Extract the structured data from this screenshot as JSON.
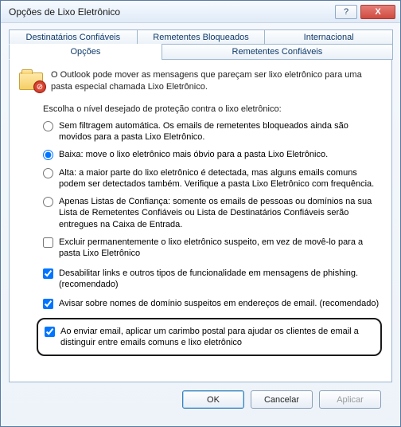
{
  "window": {
    "title": "Opções de Lixo Eletrônico",
    "help_glyph": "?",
    "close_glyph": "X"
  },
  "tabs": {
    "row1": [
      {
        "label": "Destinatários Confiáveis"
      },
      {
        "label": "Remetentes Bloqueados"
      },
      {
        "label": "Internacional"
      }
    ],
    "row2": [
      {
        "label": "Opções",
        "active": true
      },
      {
        "label": "Remetentes Confiáveis"
      }
    ]
  },
  "intro": "O Outlook pode mover as mensagens que pareçam ser lixo eletrônico para uma pasta especial chamada Lixo Eletrônico.",
  "section_label": "Escolha o nível desejado de proteção contra o lixo eletrônico:",
  "radios": {
    "none": "Sem filtragem automática. Os emails de remetentes bloqueados ainda são movidos para a pasta Lixo Eletrônico.",
    "low": "Baixa: move o lixo eletrônico mais óbvio para a pasta Lixo Eletrônico.",
    "high": "Alta: a maior parte do lixo eletrônico é detectada, mas alguns emails comuns podem ser detectados também. Verifique a pasta Lixo Eletrônico com frequência.",
    "safe": "Apenas Listas de Confiança: somente os emails de pessoas ou domínios na sua Lista de Remetentes Confiáveis ou Lista de Destinatários Confiáveis serão entregues na Caixa de Entrada."
  },
  "checks": {
    "delete": "Excluir permanentemente o lixo eletrônico suspeito, em vez de movê-lo para a pasta Lixo Eletrônico",
    "links": "Desabilitar links e outros tipos de funcionalidade em mensagens de phishing. (recomendado)",
    "domain": "Avisar sobre nomes de domínio suspeitos em endereços de email. (recomendado)",
    "postmark": "Ao enviar email, aplicar um carimbo postal para ajudar os clientes de email a distinguir entre emails comuns e lixo eletrônico"
  },
  "buttons": {
    "ok": "OK",
    "cancel": "Cancelar",
    "apply": "Aplicar"
  },
  "icon_badge": "⊘"
}
